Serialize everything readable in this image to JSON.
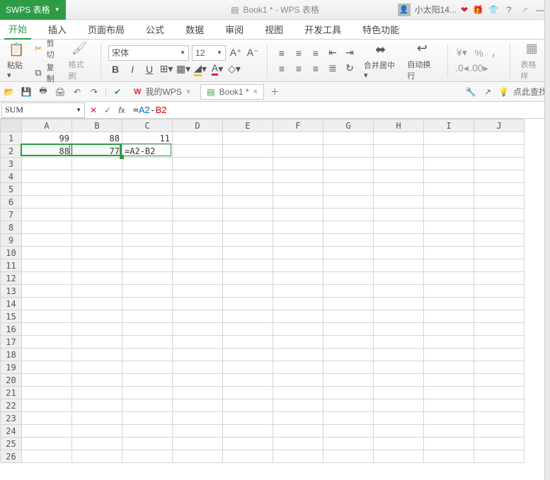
{
  "titlebar": {
    "app_name": "WPS 表格",
    "doc_title": "Book1 * - WPS 表格",
    "user_name": "小太阳14..."
  },
  "menu": {
    "tabs": [
      "开始",
      "插入",
      "页面布局",
      "公式",
      "数据",
      "审阅",
      "视图",
      "开发工具",
      "特色功能"
    ],
    "active_index": 0
  },
  "ribbon": {
    "paste": "粘贴",
    "cut": "剪切",
    "copy": "复制",
    "format_painter": "格式刷",
    "font_name": "宋体",
    "font_size": "12",
    "merge_center": "合并居中",
    "auto_wrap": "自动换行",
    "cell_format": "表格样"
  },
  "qa": {
    "my_wps": "我的WPS",
    "doc_tab": "Book1 *",
    "tip": "点此查找"
  },
  "formula_bar": {
    "name_box": "SUM",
    "formula_raw": "=A2-B2",
    "ref_a": "A2",
    "ref_b": "B2"
  },
  "chart_data": {
    "type": "table",
    "columns": [
      "A",
      "B",
      "C",
      "D",
      "E",
      "F",
      "G",
      "H",
      "I",
      "J"
    ],
    "rows": [
      {
        "A": "99",
        "B": "88",
        "C": "11"
      },
      {
        "A": "88",
        "B": "77",
        "C": "=A2-B2"
      }
    ]
  },
  "grid": {
    "editing_cell": "C2",
    "row_count": 26
  }
}
